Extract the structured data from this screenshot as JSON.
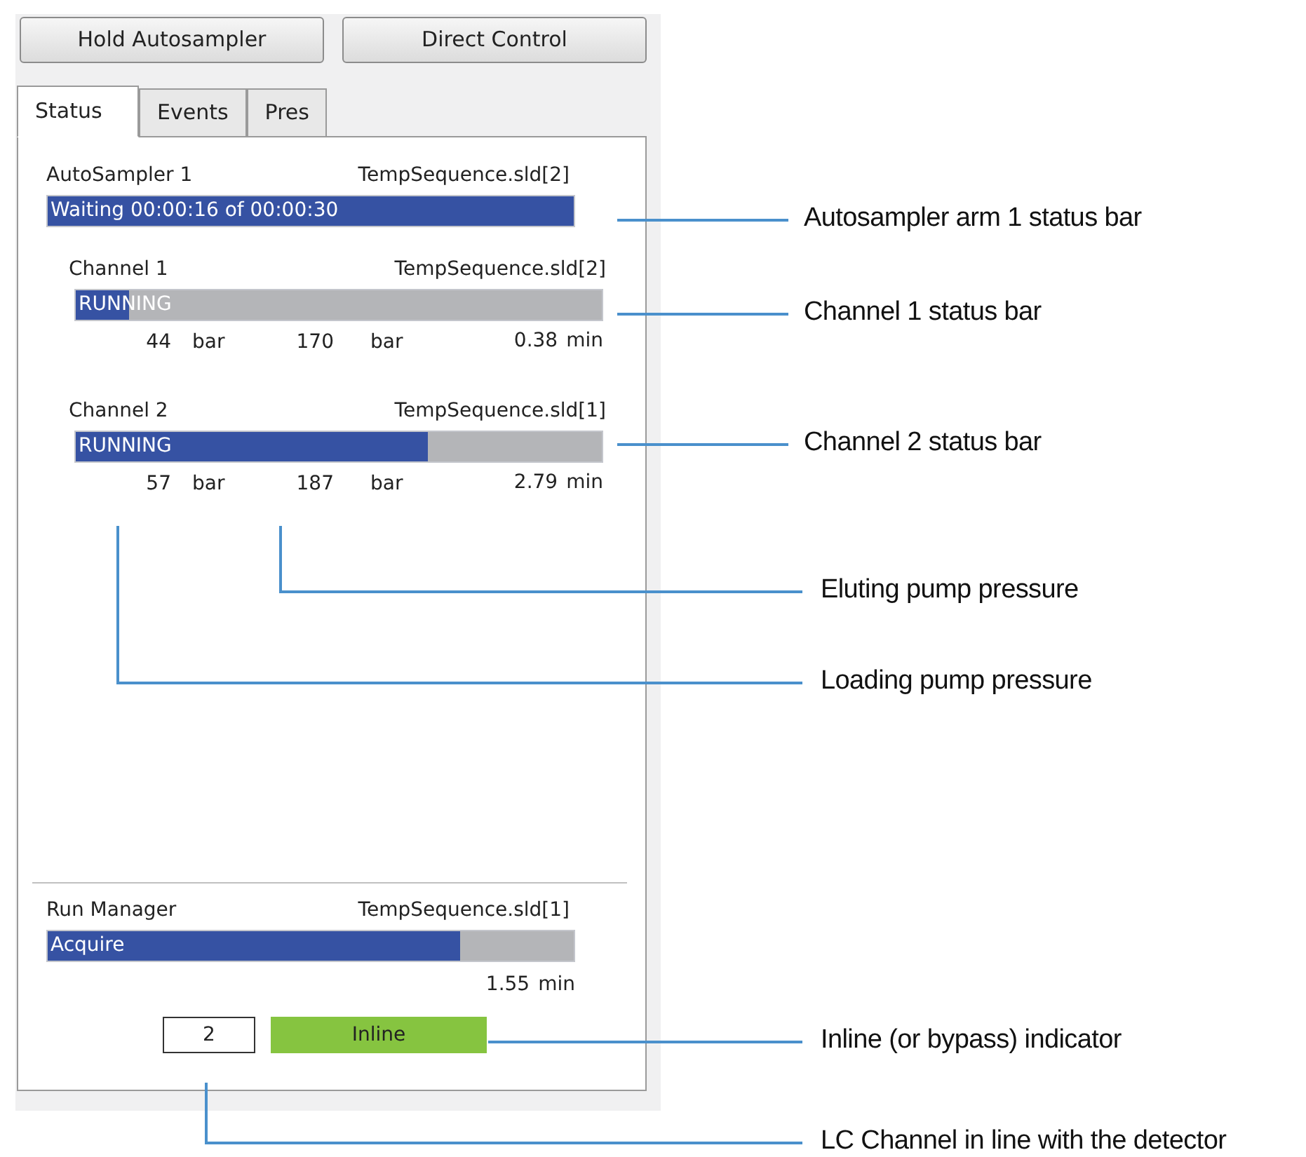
{
  "buttons": [
    "Hold Autosampler",
    "Direct Control"
  ],
  "tabs": [
    {
      "label": "Status",
      "selected": true
    },
    {
      "label": "Events",
      "selected": false
    },
    {
      "label": "Pres",
      "selected": false
    }
  ],
  "autosampler": {
    "name": "AutoSampler 1",
    "sequence": "TempSequence.sld[2]",
    "status": "Waiting 00:00:16 of 00:00:30",
    "level": 1
  },
  "channels": [
    {
      "name": "Channel 1",
      "sequence": "TempSequence.sld[2]",
      "status": "RUNNING",
      "level": 0.1,
      "loading_pressure": "44",
      "loading_unit": "bar",
      "eluting_pressure": "170",
      "eluting_unit": "bar",
      "time": "0.38",
      "time_unit": "min"
    },
    {
      "name": "Channel 2",
      "sequence": "TempSequence.sld[1]",
      "status": "RUNNING",
      "level": 0.67,
      "loading_pressure": "57",
      "loading_unit": "bar",
      "eluting_pressure": "187",
      "eluting_unit": "bar",
      "time": "2.79",
      "time_unit": "min"
    }
  ],
  "run_manager": {
    "name": "Run Manager",
    "sequence": "TempSequence.sld[1]",
    "status": "Acquire",
    "level": 0.785,
    "time": "1.55",
    "time_unit": "min"
  },
  "channel_number": "2",
  "inline_indicator": "Inline",
  "annotations": [
    {
      "text": "Autosampler arm 1 status bar"
    },
    {
      "text": "Channel 1 status bar"
    },
    {
      "text": "Channel 2 status bar"
    },
    {
      "text": "Eluting pump pressure"
    },
    {
      "text": "Loading pump pressure"
    },
    {
      "text": "Inline (or bypass) indicator"
    },
    {
      "text": "LC Channel in line with the detector"
    }
  ]
}
